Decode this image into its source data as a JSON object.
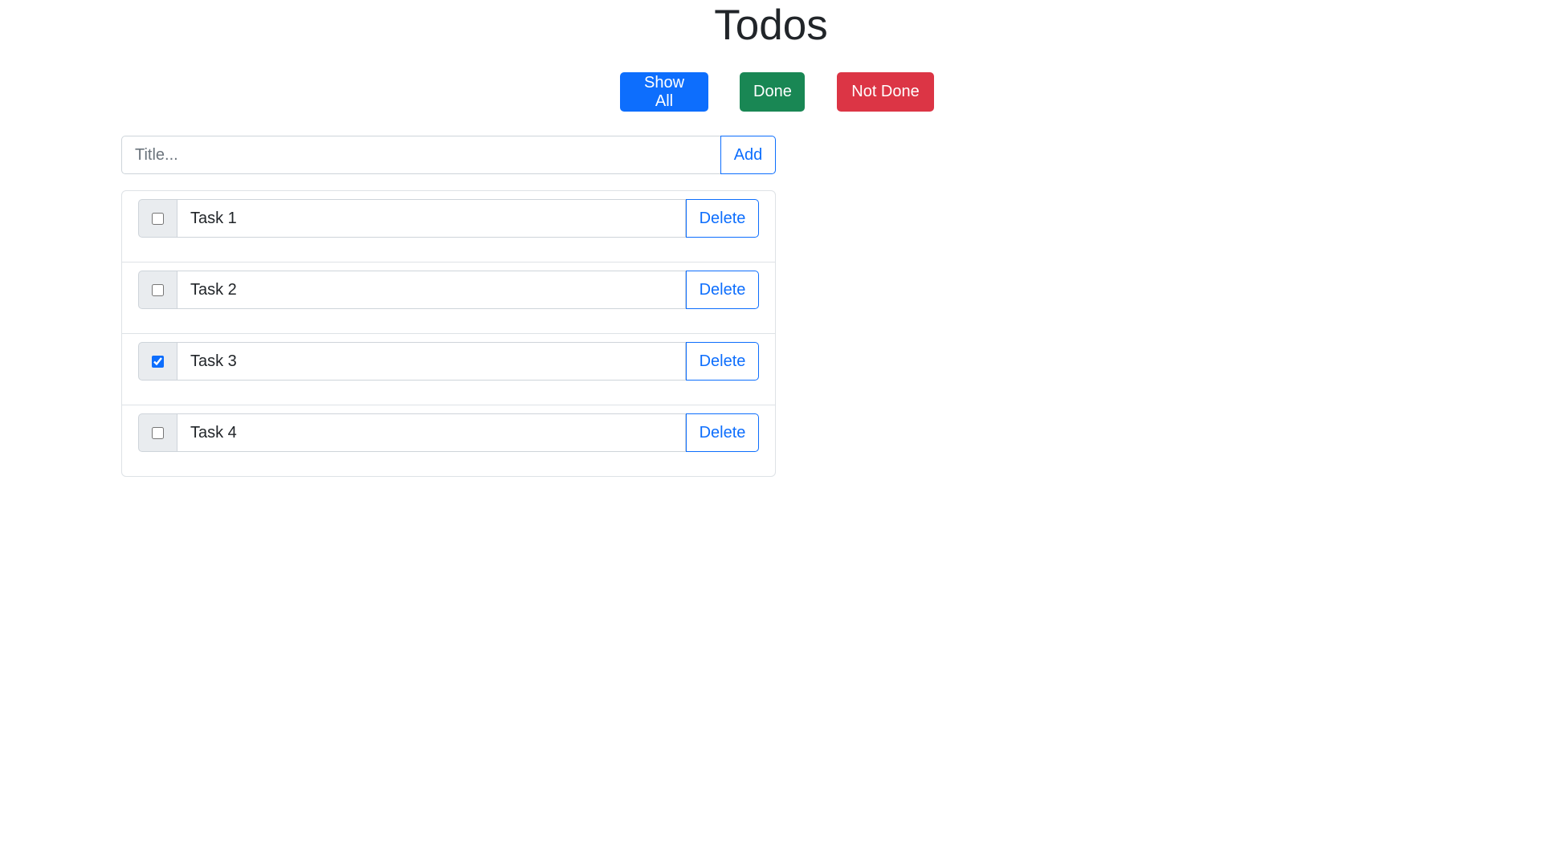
{
  "header": {
    "title": "Todos"
  },
  "filters": {
    "show_all": "Show All",
    "done": "Done",
    "not_done": "Not Done"
  },
  "add_form": {
    "placeholder": "Title...",
    "value": "",
    "button": "Add"
  },
  "todos": [
    {
      "title": "Task 1",
      "done": false,
      "delete_label": "Delete"
    },
    {
      "title": "Task 2",
      "done": false,
      "delete_label": "Delete"
    },
    {
      "title": "Task 3",
      "done": true,
      "delete_label": "Delete"
    },
    {
      "title": "Task 4",
      "done": false,
      "delete_label": "Delete"
    }
  ],
  "colors": {
    "primary": "#0d6efd",
    "success": "#198754",
    "danger": "#dc3545",
    "border": "#ced4da",
    "addon_bg": "#e9ecef"
  }
}
